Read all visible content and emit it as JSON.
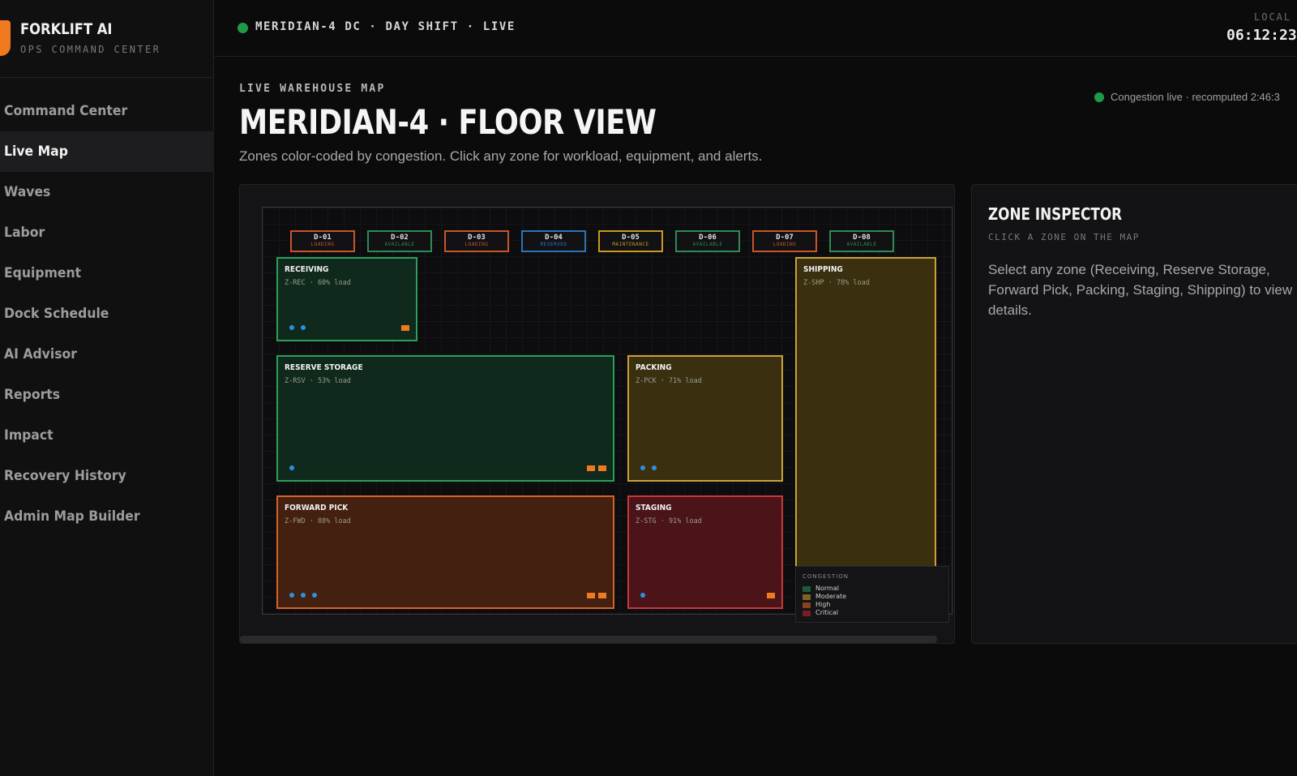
{
  "brand": {
    "name": "FORKLIFT AI",
    "subtitle": "OPS COMMAND CENTER"
  },
  "nav": {
    "items": [
      {
        "label": "Command Center",
        "active": false
      },
      {
        "label": "Live Map",
        "active": true
      },
      {
        "label": "Waves",
        "active": false
      },
      {
        "label": "Labor",
        "active": false
      },
      {
        "label": "Equipment",
        "active": false
      },
      {
        "label": "Dock Schedule",
        "active": false
      },
      {
        "label": "AI Advisor",
        "active": false
      },
      {
        "label": "Reports",
        "active": false
      },
      {
        "label": "Impact",
        "active": false
      },
      {
        "label": "Recovery History",
        "active": false
      },
      {
        "label": "Admin Map Builder",
        "active": false
      }
    ]
  },
  "topbar": {
    "site_status": "MERIDIAN-4 DC · DAY SHIFT · LIVE",
    "local_label": "LOCAL T",
    "clock": "06:12:23",
    "status_color": "#1f9a46"
  },
  "header": {
    "eyebrow": "LIVE WAREHOUSE MAP",
    "title": "MERIDIAN-4 · FLOOR VIEW",
    "description": "Zones color-coded by congestion. Click any zone for workload, equipment, and alerts.",
    "congestion_status": "Congestion live · recomputed 2:46:3"
  },
  "map": {
    "docks": [
      {
        "id": "D-01",
        "status": "LOADING",
        "color": "#c8552a"
      },
      {
        "id": "D-02",
        "status": "AVAILABLE",
        "color": "#2f8a55"
      },
      {
        "id": "D-03",
        "status": "LOADING",
        "color": "#c8552a"
      },
      {
        "id": "D-04",
        "status": "RESERVED",
        "color": "#2f72b8"
      },
      {
        "id": "D-05",
        "status": "MAINTENANCE",
        "color": "#c89a22"
      },
      {
        "id": "D-06",
        "status": "AVAILABLE",
        "color": "#2f8a55"
      },
      {
        "id": "D-07",
        "status": "LOADING",
        "color": "#c8552a"
      },
      {
        "id": "D-08",
        "status": "AVAILABLE",
        "color": "#2f8a55"
      }
    ],
    "zones": {
      "receiving": {
        "name": "RECEIVING",
        "meta": "Z-REC · 60% load",
        "load_pct": 60,
        "congestion": "Normal",
        "robots": 2,
        "forklifts": 1
      },
      "reserve": {
        "name": "RESERVE STORAGE",
        "meta": "Z-RSV · 53% load",
        "load_pct": 53,
        "congestion": "Normal",
        "robots": 1,
        "forklifts": 2
      },
      "packing": {
        "name": "PACKING",
        "meta": "Z-PCK · 71% load",
        "load_pct": 71,
        "congestion": "Moderate",
        "robots": 2,
        "forklifts": 0
      },
      "shipping": {
        "name": "SHIPPING",
        "meta": "Z-SHP · 78% load",
        "load_pct": 78,
        "congestion": "Moderate",
        "robots": 0,
        "forklifts": 0
      },
      "forward": {
        "name": "FORWARD PICK",
        "meta": "Z-FWD · 88% load",
        "load_pct": 88,
        "congestion": "High",
        "robots": 3,
        "forklifts": 2
      },
      "staging": {
        "name": "STAGING",
        "meta": "Z-STG · 91% load",
        "load_pct": 91,
        "congestion": "Critical",
        "robots": 1,
        "forklifts": 1
      }
    },
    "legend": {
      "title": "CONGESTION",
      "items": [
        {
          "label": "Normal",
          "color": "#1e5a3a"
        },
        {
          "label": "Moderate",
          "color": "#7a6420"
        },
        {
          "label": "High",
          "color": "#8a3f1e"
        },
        {
          "label": "Critical",
          "color": "#7a1c22"
        }
      ]
    }
  },
  "inspector": {
    "title": "ZONE INSPECTOR",
    "subtitle": "CLICK A ZONE ON THE MAP",
    "body": "Select any zone (Receiving, Reserve Storage, Forward Pick, Packing, Staging, Shipping) to view details."
  }
}
